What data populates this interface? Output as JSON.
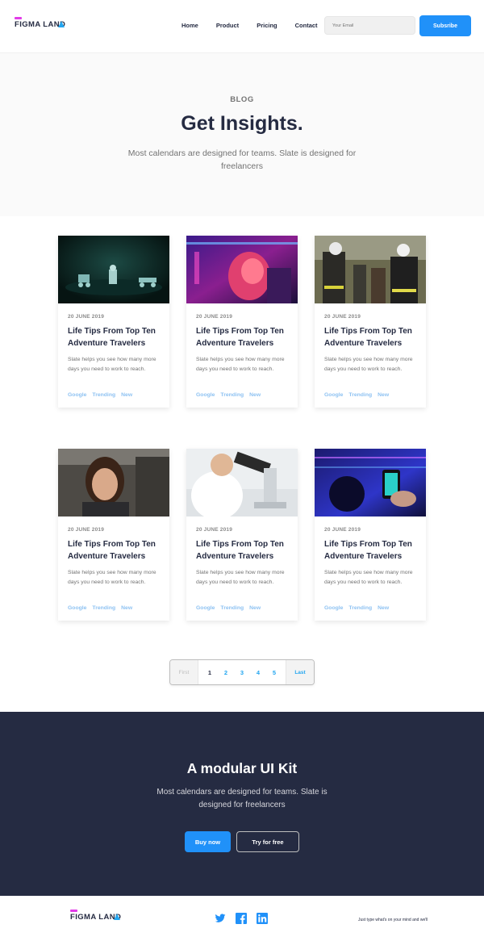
{
  "brand": {
    "name": "FIGMA LAND",
    "accent": "#2091F9",
    "logo_bar": "#E23BE8",
    "dark": "#252B42"
  },
  "nav": {
    "items": [
      "Home",
      "Product",
      "Pricing",
      "Contact"
    ]
  },
  "subscribe": {
    "placeholder": "Your Email",
    "button": "Subsribe"
  },
  "hero": {
    "kicker": "BLOG",
    "title": "Get Insights.",
    "subtitle": "Most calendars are designed for teams. Slate is designed for freelancers"
  },
  "posts": [
    {
      "date": "20 JUNE 2019",
      "title": "Life Tips From Top Ten Adventure Travelers",
      "text": "Slate helps you see how many more days you need to work to reach.",
      "tags": [
        "Google",
        "Trending",
        "New"
      ],
      "image": "robots-night-scene"
    },
    {
      "date": "20 JUNE 2019",
      "title": "Life Tips From Top Ten Adventure Travelers",
      "text": "Slate helps you see how many more days you need to work to reach.",
      "tags": [
        "Google",
        "Trending",
        "New"
      ],
      "image": "man-neon-lab"
    },
    {
      "date": "20 JUNE 2019",
      "title": "Life Tips From Top Ten Adventure Travelers",
      "text": "Slate helps you see how many more days you need to work to reach.",
      "tags": [
        "Google",
        "Trending",
        "New"
      ],
      "image": "firefighters-rescue"
    },
    {
      "date": "20 JUNE 2019",
      "title": "Life Tips From Top Ten Adventure Travelers",
      "text": "Slate helps you see how many more days you need to work to reach.",
      "tags": [
        "Google",
        "Trending",
        "New"
      ],
      "image": "woman-portrait"
    },
    {
      "date": "20 JUNE 2019",
      "title": "Life Tips From Top Ten Adventure Travelers",
      "text": "Slate helps you see how many more days you need to work to reach.",
      "tags": [
        "Google",
        "Trending",
        "New"
      ],
      "image": "scientist-microscope"
    },
    {
      "date": "20 JUNE 2019",
      "title": "Life Tips From Top Ten Adventure Travelers",
      "text": "Slate helps you see how many more days you need to work to reach.",
      "tags": [
        "Google",
        "Trending",
        "New"
      ],
      "image": "phone-blue-light"
    }
  ],
  "pagination": {
    "first": "First",
    "pages": [
      "1",
      "2",
      "3",
      "4",
      "5"
    ],
    "current": "1",
    "last": "Last"
  },
  "cta": {
    "title": "A modular UI Kit",
    "subtitle": "Most calendars are designed for teams. Slate is designed for freelancers",
    "primary": "Buy now",
    "secondary": "Try for free"
  },
  "footer": {
    "brand": "FIGMA LAND",
    "social": [
      "twitter-icon",
      "facebook-icon",
      "linkedin-icon"
    ],
    "note": "Just type what's on your mind and we'll"
  }
}
